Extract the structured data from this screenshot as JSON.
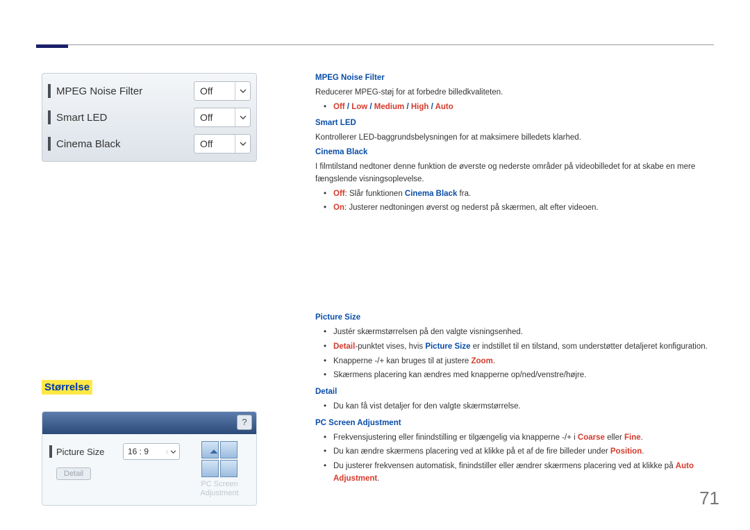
{
  "osd1": {
    "rows": [
      {
        "label": "MPEG Noise Filter",
        "value": "Off"
      },
      {
        "label": "Smart LED",
        "value": "Off"
      },
      {
        "label": "Cinema Black",
        "value": "Off"
      }
    ]
  },
  "sectionTitle": "Størrelse",
  "osd2": {
    "help": "?",
    "label": "Picture Size",
    "value": "16 : 9",
    "detail": "Detail",
    "pcLabel1": "PC Screen",
    "pcLabel2": "Adjustment"
  },
  "right": {
    "mpeg": {
      "title": "MPEG Noise Filter",
      "desc": "Reducerer MPEG-støj for at forbedre billedkvaliteten.",
      "opt_off": "Off",
      "opt_low": "Low",
      "opt_med": "Medium",
      "opt_high": "High",
      "opt_auto": "Auto",
      "sep": " / "
    },
    "smartled": {
      "title": "Smart LED",
      "desc": "Kontrollerer LED-baggrundsbelysningen for at maksimere billedets klarhed."
    },
    "cinema": {
      "title": "Cinema Black",
      "desc": "I filmtilstand nedtoner denne funktion de øverste og nederste områder på videobilledet for at skabe en mere fængslende visningsoplevelse.",
      "b1_off": "Off",
      "b1_rest": ": Slår funktionen ",
      "b1_cb": "Cinema Black",
      "b1_end": " fra.",
      "b2_on": "On",
      "b2_rest": ": Justerer nedtoningen øverst og nederst på skærmen, alt efter videoen."
    },
    "picsize": {
      "title": "Picture Size",
      "b1": "Justér skærmstørrelsen på den valgte visningsenhed.",
      "b2_a": "Detail",
      "b2_b": "-punktet vises, hvis ",
      "b2_c": "Picture Size",
      "b2_d": " er indstillet til en tilstand, som understøtter detaljeret konfiguration.",
      "b3_a": "Knapperne -/+ kan bruges til at justere ",
      "b3_b": "Zoom",
      "b3_c": ".",
      "b4": "Skærmens placering kan ændres med knapperne op/ned/venstre/højre."
    },
    "detail": {
      "title": "Detail",
      "b1": "Du kan få vist detaljer for den valgte skærmstørrelse."
    },
    "pcadj": {
      "title": "PC Screen Adjustment",
      "b1_a": "Frekvensjustering eller finindstilling er tilgængelig via knapperne -/+ i ",
      "b1_b": "Coarse",
      "b1_c": " eller ",
      "b1_d": "Fine",
      "b1_e": ".",
      "b2_a": "Du kan ændre skærmens placering ved at klikke på et af de fire billeder under ",
      "b2_b": "Position",
      "b2_c": ".",
      "b3_a": "Du justerer frekvensen automatisk, finindstiller eller ændrer skærmens placering ved at klikke på ",
      "b3_b": "Auto Adjustment",
      "b3_c": "."
    }
  },
  "pageNum": "71"
}
